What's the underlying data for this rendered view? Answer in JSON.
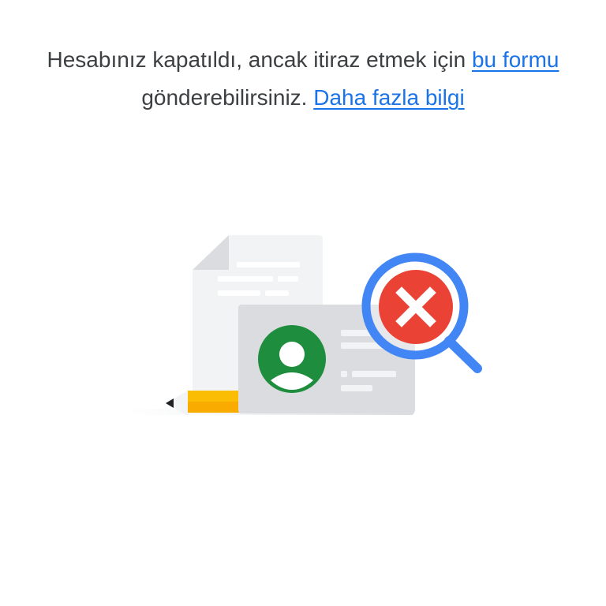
{
  "message": {
    "text_before": "Hesabınız kapatıldı, ancak itiraz etmek için ",
    "form_link": "bu formu",
    "text_middle": " gönderebilirsiniz. ",
    "learn_more_link": "Daha fazla bilgi"
  },
  "illustration": {
    "icons": [
      "document-icon",
      "pencil-icon",
      "id-card-icon",
      "avatar-icon",
      "magnifier-icon",
      "error-x-icon"
    ],
    "colors": {
      "link": "#1a73e8",
      "text": "#3c4043",
      "avatar_green": "#1e8e3e",
      "error_red": "#ea4335",
      "magnifier_blue": "#4285f4",
      "pencil_yellow": "#fbbc04",
      "card_gray": "#dadce0",
      "doc_gray": "#f1f3f4"
    }
  }
}
